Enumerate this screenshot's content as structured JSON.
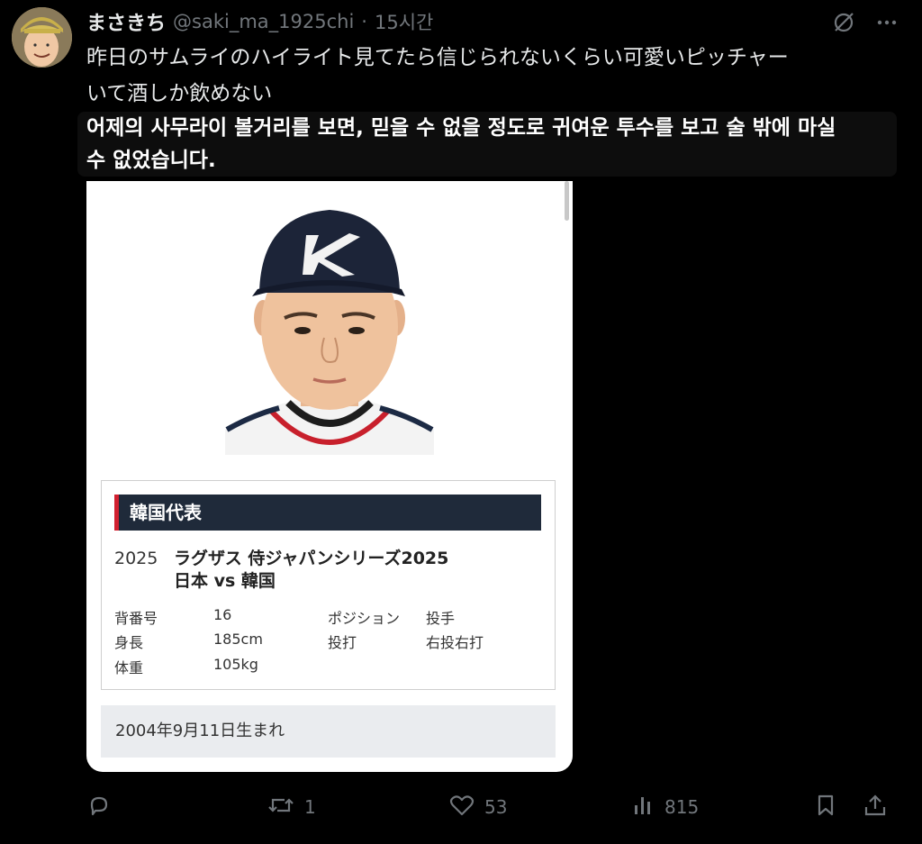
{
  "tweet": {
    "display_name": "まさきち",
    "handle": "@saki_ma_1925chi",
    "separator": "·",
    "time": "15시간",
    "text_lines": [
      "昨日のサムライのハイライト見てたら信じられないくらい可愛いピッチャー",
      "いて酒しか飲めない"
    ],
    "translation_lines": [
      "어제의 사무라이 볼거리를 보면, 믿을 수 없을 정도로 귀여운 투수를 보고 술 밖에 마실",
      "수 없었습니다."
    ]
  },
  "player_card": {
    "team": "韓国代表",
    "season_year": "2025",
    "event_line1": "ラグザス 侍ジャパンシリーズ2025",
    "event_line2": "日本 vs 韓国",
    "stats": [
      {
        "label": "背番号",
        "value": "16"
      },
      {
        "label": "身長",
        "value": "185cm"
      },
      {
        "label": "体重",
        "value": "105kg"
      },
      {
        "label": "ポジション",
        "value": "投手"
      },
      {
        "label": "投打",
        "value": "右投右打"
      }
    ],
    "birthdate": "2004年9月11日生まれ"
  },
  "actions": {
    "reply_count": "",
    "retweet_count": "1",
    "like_count": "53",
    "views_count": "815"
  },
  "colors": {
    "background": "#000000",
    "text": "#e7e9ea",
    "muted": "#71767b",
    "team_header": "#1f2a3a",
    "team_accent": "#d12030"
  },
  "icons": [
    "grok-icon",
    "more-icon",
    "reply-icon",
    "retweet-icon",
    "like-icon",
    "views-icon",
    "bookmark-icon",
    "share-icon"
  ]
}
